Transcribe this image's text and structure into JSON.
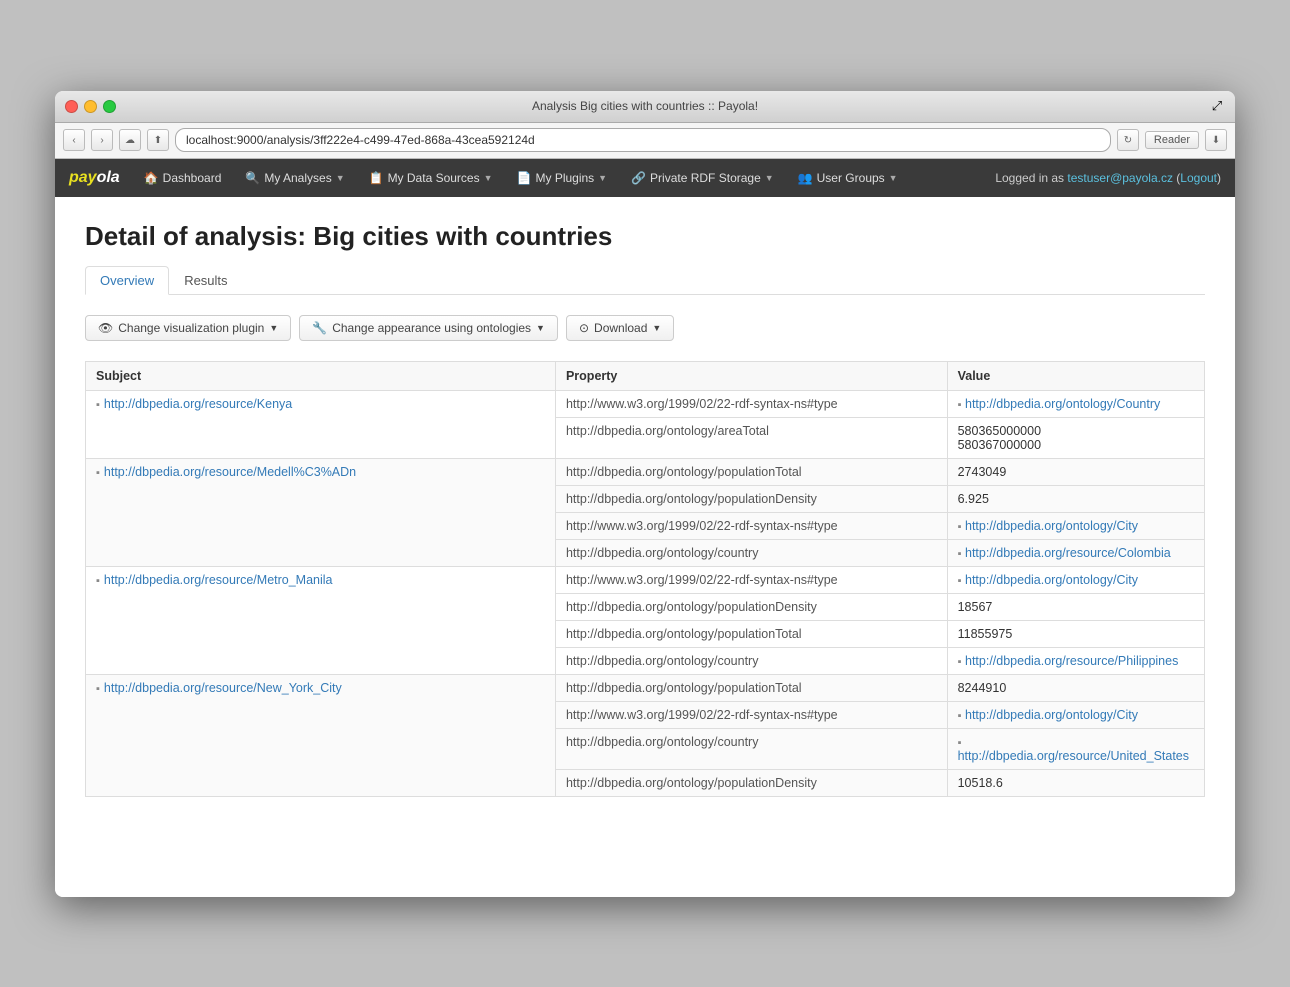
{
  "window": {
    "title": "Analysis Big cities with countries :: Payola!"
  },
  "addressbar": {
    "url": "localhost:9000/analysis/3ff222e4-c499-47ed-868a-43cea592124d"
  },
  "navbar": {
    "logo": "payola",
    "items": [
      {
        "id": "dashboard",
        "label": "Dashboard",
        "icon": "🏠",
        "hasDropdown": false
      },
      {
        "id": "my-analyses",
        "label": "My Analyses",
        "icon": "🔍",
        "hasDropdown": true
      },
      {
        "id": "my-data-sources",
        "label": "My Data Sources",
        "icon": "📋",
        "hasDropdown": true
      },
      {
        "id": "my-plugins",
        "label": "My Plugins",
        "icon": "📄",
        "hasDropdown": true
      },
      {
        "id": "private-rdf-storage",
        "label": "Private RDF Storage",
        "icon": "🔗",
        "hasDropdown": true
      },
      {
        "id": "user-groups",
        "label": "User Groups",
        "icon": "👥",
        "hasDropdown": true
      }
    ],
    "logged_in_text": "Logged in as ",
    "username": "testuser@payola.cz",
    "logout_label": "Logout"
  },
  "page": {
    "title": "Detail of analysis: Big cities with countries",
    "tabs": [
      {
        "id": "overview",
        "label": "Overview",
        "active": true
      },
      {
        "id": "results",
        "label": "Results",
        "active": false
      }
    ],
    "toolbar": {
      "visualization_btn": "Change visualization plugin",
      "appearance_btn": "Change appearance using ontologies",
      "download_btn": "Download"
    },
    "table": {
      "columns": [
        "Subject",
        "Property",
        "Value"
      ],
      "rows": [
        {
          "subject": "http://dbpedia.org/resource/Kenya",
          "subject_url": "http://dbpedia.org/resource/Kenya",
          "properties": [
            {
              "property": "http://www.w3.org/1999/02/22-rdf-syntax-ns#type",
              "value": "http://dbpedia.org/ontology/Country",
              "value_url": "http://dbpedia.org/ontology/Country",
              "is_link": true
            },
            {
              "property": "http://dbpedia.org/ontology/areaTotal",
              "value": "580365000000\n580367000000",
              "is_link": false
            }
          ]
        },
        {
          "subject": "http://dbpedia.org/resource/Medell%C3%ADn",
          "subject_url": "http://dbpedia.org/resource/Medell%C3%ADn",
          "properties": [
            {
              "property": "http://dbpedia.org/ontology/populationTotal",
              "value": "2743049",
              "is_link": false
            },
            {
              "property": "http://dbpedia.org/ontology/populationDensity",
              "value": "6.925",
              "is_link": false
            },
            {
              "property": "http://www.w3.org/1999/02/22-rdf-syntax-ns#type",
              "value": "http://dbpedia.org/ontology/City",
              "value_url": "http://dbpedia.org/ontology/City",
              "is_link": true
            },
            {
              "property": "http://dbpedia.org/ontology/country",
              "value": "http://dbpedia.org/resource/Colombia",
              "value_url": "http://dbpedia.org/resource/Colombia",
              "is_link": true
            }
          ]
        },
        {
          "subject": "http://dbpedia.org/resource/Metro_Manila",
          "subject_url": "http://dbpedia.org/resource/Metro_Manila",
          "properties": [
            {
              "property": "http://www.w3.org/1999/02/22-rdf-syntax-ns#type",
              "value": "http://dbpedia.org/ontology/City",
              "value_url": "http://dbpedia.org/ontology/City",
              "is_link": true
            },
            {
              "property": "http://dbpedia.org/ontology/populationDensity",
              "value": "18567",
              "is_link": false
            },
            {
              "property": "http://dbpedia.org/ontology/populationTotal",
              "value": "11855975",
              "is_link": false
            },
            {
              "property": "http://dbpedia.org/ontology/country",
              "value": "http://dbpedia.org/resource/Philippines",
              "value_url": "http://dbpedia.org/resource/Philippines",
              "is_link": true
            }
          ]
        },
        {
          "subject": "http://dbpedia.org/resource/New_York_City",
          "subject_url": "http://dbpedia.org/resource/New_York_City",
          "properties": [
            {
              "property": "http://dbpedia.org/ontology/populationTotal",
              "value": "8244910",
              "is_link": false
            },
            {
              "property": "http://www.w3.org/1999/02/22-rdf-syntax-ns#type",
              "value": "http://dbpedia.org/ontology/City",
              "value_url": "http://dbpedia.org/ontology/City",
              "is_link": true
            },
            {
              "property": "http://dbpedia.org/ontology/country",
              "value": "http://dbpedia.org/resource/United_States",
              "value_url": "http://dbpedia.org/resource/United_States",
              "is_link": true,
              "has_icon": true
            },
            {
              "property": "http://dbpedia.org/ontology/populationDensity",
              "value": "10518.6",
              "is_link": false
            }
          ]
        }
      ]
    }
  }
}
